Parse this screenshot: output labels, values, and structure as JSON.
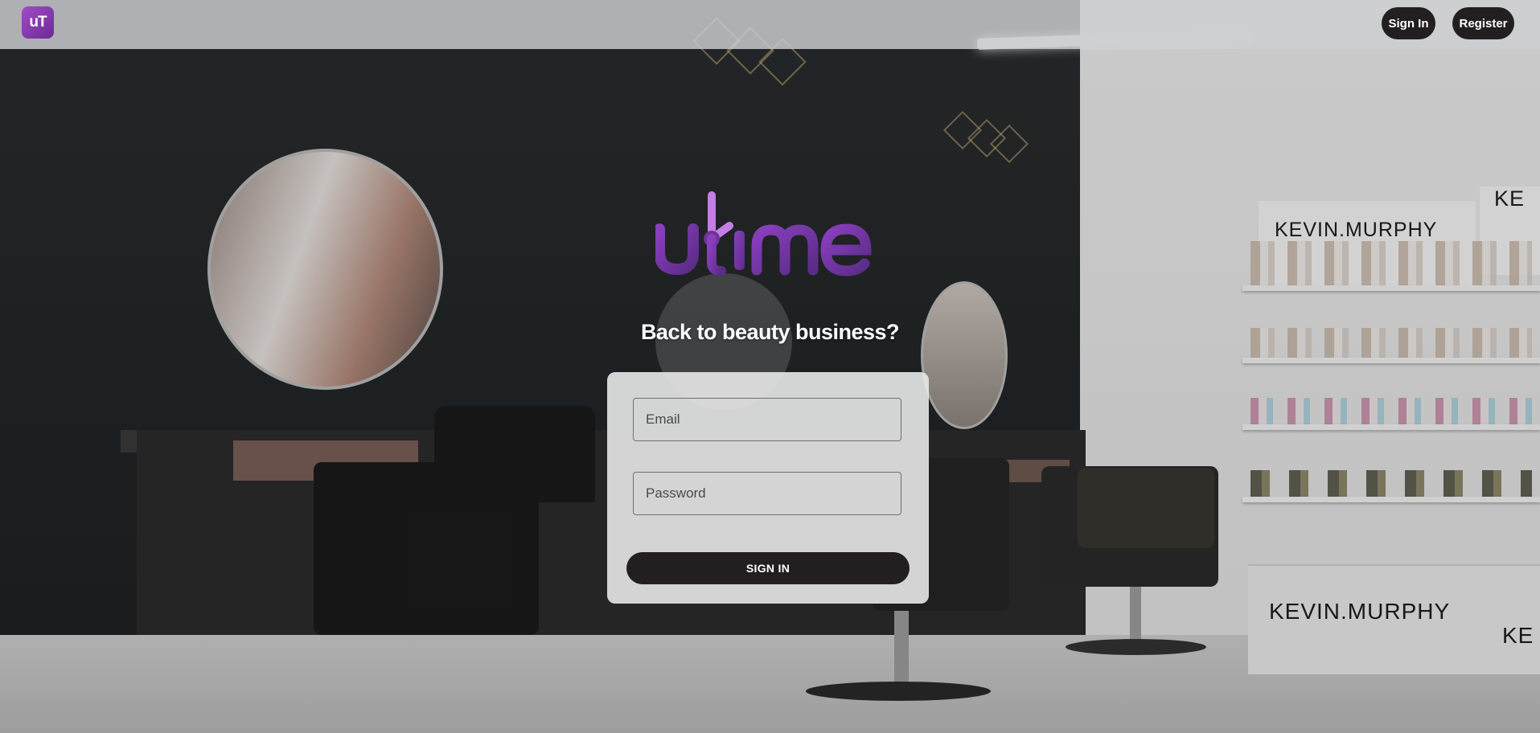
{
  "header": {
    "logo_text": "uT",
    "sign_in_label": "Sign In",
    "register_label": "Register"
  },
  "brand": {
    "wordmark": "utime",
    "colors": {
      "primary": "#7a3ba3",
      "accent": "#b36ad8"
    }
  },
  "background": {
    "brand_text_1": "KEVIN.MURPHY",
    "brand_text_2": "KE",
    "brand_text_3": "KEVIN.MURPHY",
    "brand_text_4": "KE"
  },
  "main": {
    "headline": "Back to beauty business?",
    "form": {
      "email_placeholder": "Email",
      "email_value": "",
      "password_placeholder": "Password",
      "password_value": "",
      "submit_label": "SIGN IN"
    }
  },
  "colors": {
    "button_bg": "#231f20",
    "button_text": "#ffffff",
    "header_bg": "#cdd0d2",
    "card_bg": "#e8e8e8"
  }
}
